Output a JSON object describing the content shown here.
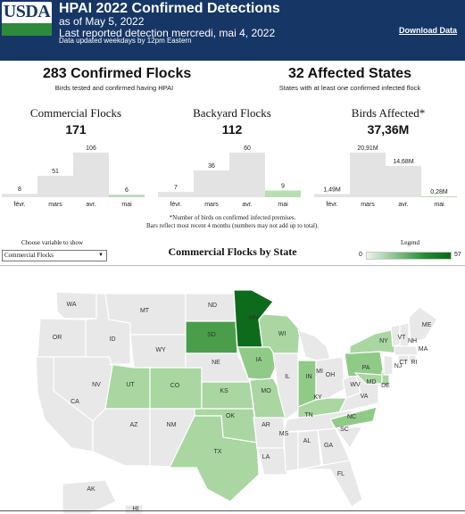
{
  "header": {
    "logo": "USDA",
    "title": "HPAI 2022 Confirmed Detections",
    "as_of": "as of May 5, 2022",
    "last_reported": "Last reported detection mercredi, mai 4, 2022",
    "update_note": "Data updated weekdays by 12pm Eastern",
    "download": "Download Data"
  },
  "summary": {
    "flocks": {
      "value": "283 Confirmed Flocks",
      "caption": "Birds tested and confirmed having HPAI"
    },
    "states": {
      "value": "32 Affected States",
      "caption": "States with at least one confirmed infected flock"
    }
  },
  "chart_data": [
    {
      "type": "bar",
      "title": "Commercial Flocks",
      "total": "171",
      "categories": [
        "févr.",
        "mars",
        "avr.",
        "mai"
      ],
      "values": [
        8,
        51,
        106,
        6
      ],
      "labels": [
        "8",
        "51",
        "106",
        "6"
      ],
      "ylim": [
        0,
        106
      ],
      "highlight_last": true
    },
    {
      "type": "bar",
      "title": "Backyard Flocks",
      "total": "112",
      "categories": [
        "févr.",
        "mars",
        "avr.",
        "mai"
      ],
      "values": [
        7,
        36,
        60,
        9
      ],
      "labels": [
        "7",
        "36",
        "60",
        "9"
      ],
      "ylim": [
        0,
        60
      ],
      "highlight_last": true
    },
    {
      "type": "bar",
      "title": "Birds Affected*",
      "total": "37,36M",
      "categories": [
        "févr.",
        "mars",
        "avr.",
        "mai"
      ],
      "values": [
        1.49,
        20.91,
        14.68,
        0.28
      ],
      "labels": [
        "1,49M",
        "20,91M",
        "14,68M",
        "0,28M"
      ],
      "ylim": [
        0,
        20.91
      ],
      "highlight_last": true
    }
  ],
  "notes": {
    "line1": "*Number of birds on confirmed infected premises.",
    "line2": "Bars reflect most recent 4 months (numbers may not add up to total)."
  },
  "controls": {
    "label": "Choose variable to show",
    "selected": "Commercial Flocks"
  },
  "map": {
    "title": "Commercial Flocks by State",
    "legend_label": "Legend",
    "legend_min": "0",
    "legend_max": "57",
    "states": [
      "WA",
      "MT",
      "ND",
      "MN",
      "OR",
      "ID",
      "WY",
      "SD",
      "WI",
      "NY",
      "ME",
      "VT",
      "NH",
      "MA",
      "CT",
      "RI",
      "NE",
      "IA",
      "MI",
      "PA",
      "NJ",
      "NV",
      "UT",
      "CO",
      "IL",
      "IN",
      "OH",
      "MD",
      "DE",
      "CA",
      "KS",
      "MO",
      "KY",
      "WV",
      "VA",
      "AZ",
      "NM",
      "OK",
      "TN",
      "NC",
      "AR",
      "SC",
      "MS",
      "AL",
      "GA",
      "TX",
      "LA",
      "FL",
      "AK",
      "HI"
    ]
  },
  "colors": {
    "header_bg": "#163766",
    "usda_green": "#2d8a3d",
    "bar": "#e3e3e3",
    "bar_highlight": "#b9ddb3",
    "state_empty": "#e8e8e8",
    "state_light": "#a9d6a1",
    "state_mid": "#8fcb87",
    "state_sd": "#4a9e4b",
    "state_mn": "#0e6b1b"
  }
}
